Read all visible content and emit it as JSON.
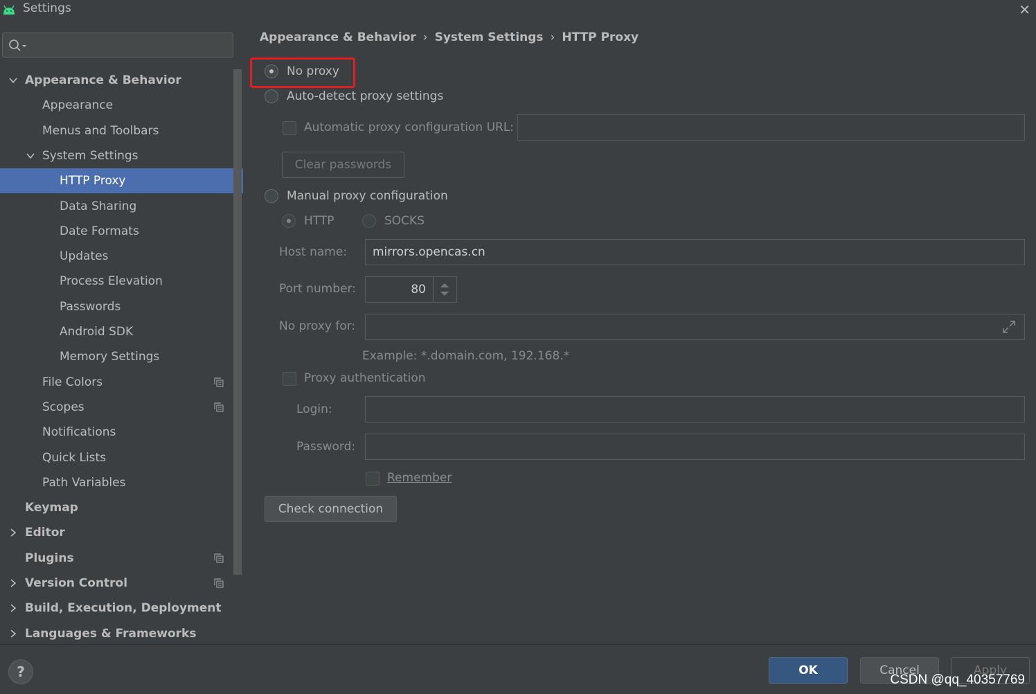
{
  "window": {
    "title": "Settings"
  },
  "sidebar": {
    "search_placeholder": "",
    "items": [
      {
        "label": "Appearance & Behavior",
        "level": 0,
        "expanded": true,
        "bold": true
      },
      {
        "label": "Appearance",
        "level": 1
      },
      {
        "label": "Menus and Toolbars",
        "level": 1
      },
      {
        "label": "System Settings",
        "level": 1,
        "expanded": true
      },
      {
        "label": "HTTP Proxy",
        "level": 2,
        "selected": true
      },
      {
        "label": "Data Sharing",
        "level": 2
      },
      {
        "label": "Date Formats",
        "level": 2
      },
      {
        "label": "Updates",
        "level": 2
      },
      {
        "label": "Process Elevation",
        "level": 2
      },
      {
        "label": "Passwords",
        "level": 2
      },
      {
        "label": "Android SDK",
        "level": 2
      },
      {
        "label": "Memory Settings",
        "level": 2
      },
      {
        "label": "File Colors",
        "level": 1,
        "copy_icon": true
      },
      {
        "label": "Scopes",
        "level": 1,
        "copy_icon": true
      },
      {
        "label": "Notifications",
        "level": 1
      },
      {
        "label": "Quick Lists",
        "level": 1
      },
      {
        "label": "Path Variables",
        "level": 1
      },
      {
        "label": "Keymap",
        "level": 0,
        "bold": true
      },
      {
        "label": "Editor",
        "level": 0,
        "bold": true,
        "collapsed": true
      },
      {
        "label": "Plugins",
        "level": 0,
        "bold": true,
        "copy_icon": true
      },
      {
        "label": "Version Control",
        "level": 0,
        "bold": true,
        "collapsed": true,
        "copy_icon": true
      },
      {
        "label": "Build, Execution, Deployment",
        "level": 0,
        "bold": true,
        "collapsed": true
      },
      {
        "label": "Languages & Frameworks",
        "level": 0,
        "bold": true,
        "collapsed": true
      }
    ]
  },
  "breadcrumb": [
    "Appearance & Behavior",
    "System Settings",
    "HTTP Proxy"
  ],
  "breadcrumb_sep": "›",
  "proxy": {
    "no_proxy": "No proxy",
    "auto_detect": "Auto-detect proxy settings",
    "auto_config_url_label": "Automatic proxy configuration URL:",
    "auto_config_url_value": "",
    "clear_passwords": "Clear passwords",
    "manual": "Manual proxy configuration",
    "http": "HTTP",
    "socks": "SOCKS",
    "host_label": "Host name:",
    "host_value": "mirrors.opencas.cn",
    "port_label": "Port number:",
    "port_value": "80",
    "no_proxy_for_label": "No proxy for:",
    "no_proxy_for_value": "",
    "example": "Example: *.domain.com, 192.168.*",
    "auth_label": "Proxy authentication",
    "login_label": "Login:",
    "login_value": "",
    "password_label": "Password:",
    "password_value": "",
    "remember": "Remember",
    "check_connection": "Check connection"
  },
  "footer": {
    "help": "?",
    "ok": "OK",
    "cancel": "Cancel",
    "apply": "Apply",
    "watermark": "CSDN @qq_40357769"
  },
  "colors": {
    "background": "#3c3f41",
    "selection": "#4b6eaf",
    "ok_button": "#365880",
    "highlight": "#e02020",
    "android_green": "#3ddc84"
  }
}
